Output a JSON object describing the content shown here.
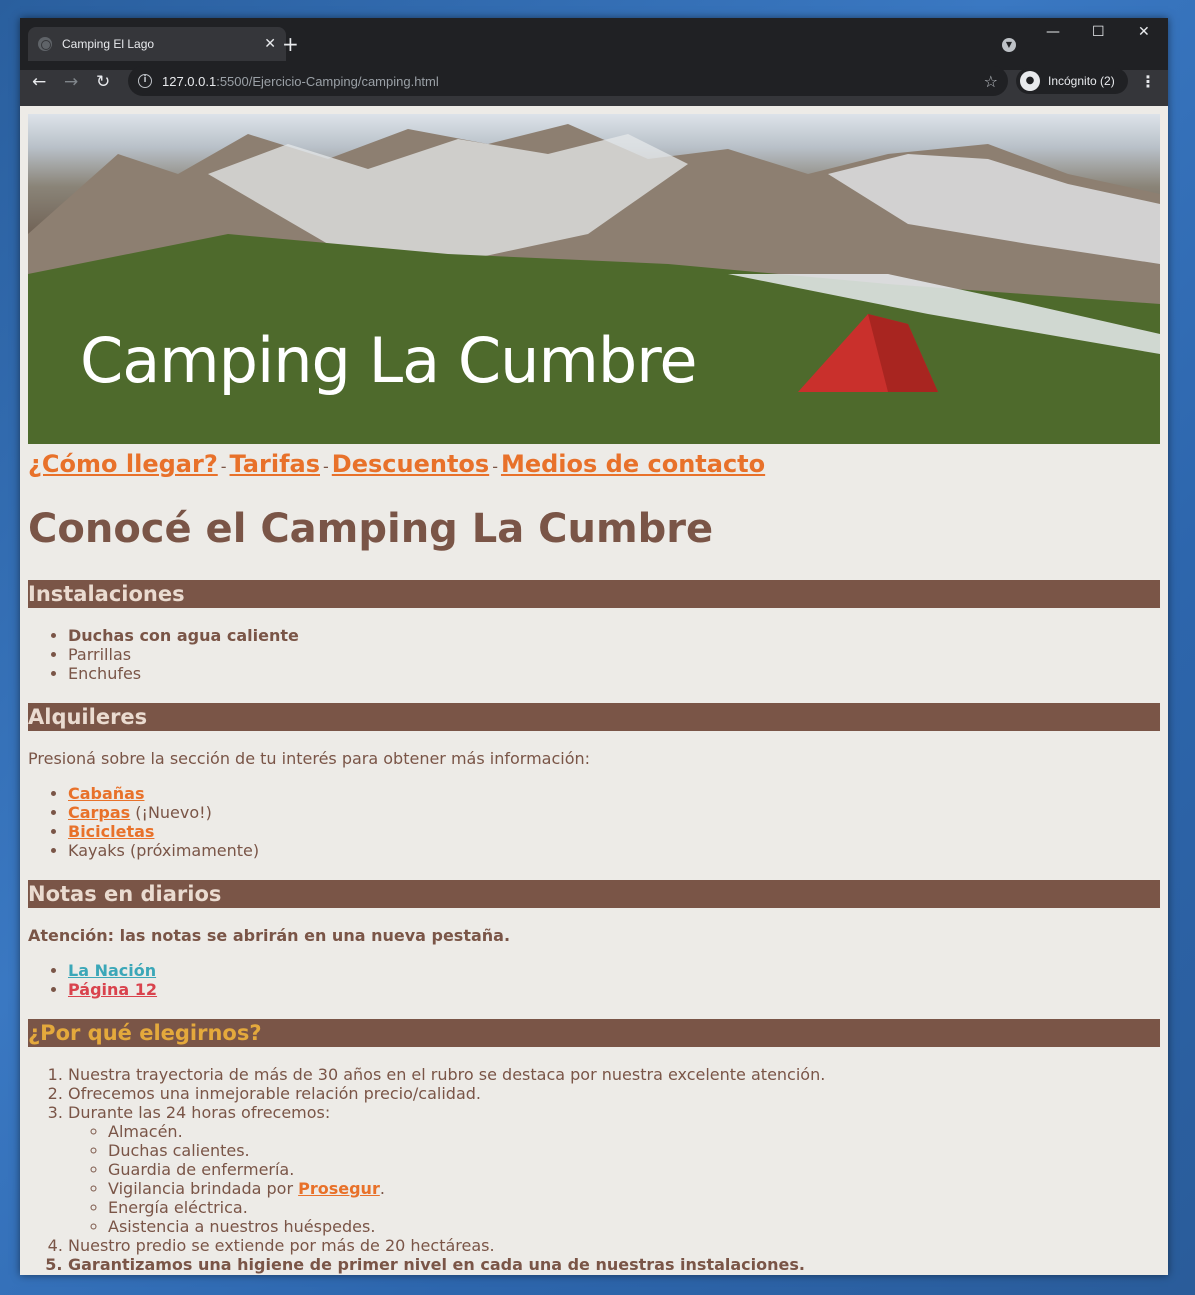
{
  "browser": {
    "tab_title": "Camping El Lago",
    "tab_close": "✕",
    "new_tab": "+",
    "url_host": "127.0.0.1",
    "url_rest": ":5500/Ejercicio-Camping/camping.html",
    "incognito_label": "Incógnito (2)",
    "min": "—",
    "max": "☐",
    "close": "✕"
  },
  "banner": {
    "title": "Camping La Cumbre"
  },
  "nav": {
    "items": [
      "¿Cómo llegar?",
      "Tarifas",
      "Descuentos",
      "Medios de contacto"
    ],
    "separator": "-"
  },
  "main": {
    "heading": "Conocé el Camping La Cumbre",
    "instalaciones": {
      "title": "Instalaciones",
      "items": [
        "Duchas con agua caliente",
        "Parrillas",
        "Enchufes"
      ]
    },
    "alquileres": {
      "title": "Alquileres",
      "intro": "Presioná sobre la sección de tu interés para obtener más información:",
      "items": [
        {
          "link": "Cabañas",
          "note": ""
        },
        {
          "link": "Carpas",
          "note": " (¡Nuevo!)"
        },
        {
          "link": "Bicicletas",
          "note": ""
        },
        {
          "text": "Kayaks (próximamente)"
        }
      ]
    },
    "notas": {
      "title": "Notas en diarios",
      "warning": "Atención: las notas se abrirán en una nueva pestaña.",
      "items": [
        "La Nación",
        "Página 12"
      ]
    },
    "porque": {
      "title": "¿Por qué elegirnos?",
      "items": [
        "Nuestra trayectoria de más de 30 años en el rubro se destaca por nuestra excelente atención.",
        "Ofrecemos una inmejorable relación precio/calidad.",
        "Durante las 24 horas ofrecemos:",
        "Nuestro predio se extiende por más de 20 hectáreas.",
        "Garantizamos una higiene de primer nivel en cada una de nuestras instalaciones."
      ],
      "sub_items": [
        "Almacén.",
        "Duchas calientes.",
        "Guardia de enfermería.",
        "Vigilancia brindada por ",
        "Energía eléctrica.",
        "Asistencia a nuestros huéspedes."
      ],
      "prosegur_link": "Prosegur",
      "prosegur_after": "."
    }
  }
}
